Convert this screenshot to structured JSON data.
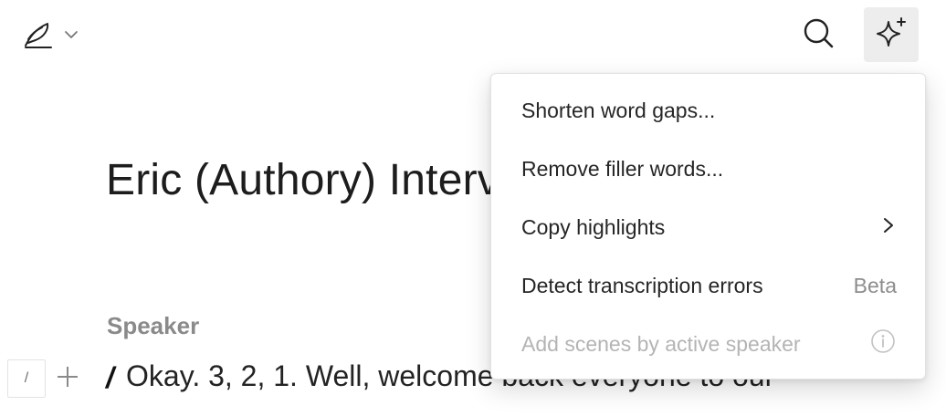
{
  "toolbar": {
    "logo_icon": "feather-icon",
    "logo_dropdown_icon": "chevron-down-icon",
    "search_icon": "search-icon",
    "ai_icon": "sparkle-icon"
  },
  "document": {
    "title": "Eric (Authory) Interv",
    "speaker": "Speaker",
    "gutter_marker": "/",
    "transcript_first_line": "Okay. 3, 2, 1. Well, welcome back everyone to our"
  },
  "menu": {
    "items": [
      {
        "label": "Shorten word gaps...",
        "enabled": true
      },
      {
        "label": "Remove filler words...",
        "enabled": true
      },
      {
        "label": "Copy highlights",
        "enabled": true,
        "icon": "chevron-right-icon"
      },
      {
        "label": "Detect transcription errors",
        "enabled": true,
        "badge": "Beta"
      },
      {
        "label": "Add scenes by active speaker",
        "enabled": false,
        "icon": "info-icon"
      }
    ]
  },
  "colors": {
    "accent_button_bg": "#ededed",
    "disabled_text": "#b4b4b4",
    "muted_text": "#8a8a8a"
  }
}
